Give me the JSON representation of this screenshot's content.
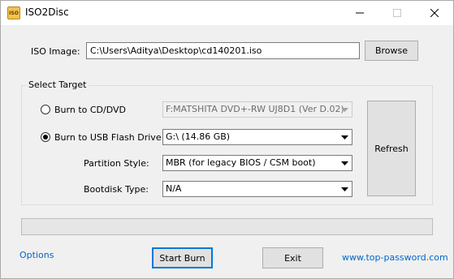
{
  "window": {
    "title": "ISO2Disc",
    "icon_text": "ISO"
  },
  "iso_image": {
    "label": "ISO Image:",
    "value": "C:\\Users\\Aditya\\Desktop\\cd140201.iso",
    "browse_label": "Browse"
  },
  "select_target": {
    "title": "Select Target",
    "burn_cd": {
      "label": "Burn to CD/DVD",
      "selected": false,
      "drive": "F:MATSHITA DVD+-RW UJ8D1 (Ver D.02)"
    },
    "burn_usb": {
      "label": "Burn to USB Flash Drive",
      "selected": true,
      "drive": "G:\\ (14.86 GB)"
    },
    "partition_style": {
      "label": "Partition Style:",
      "value": "MBR (for legacy BIOS / CSM boot)"
    },
    "bootdisk_type": {
      "label": "Bootdisk Type:",
      "value": "N/A"
    },
    "refresh_label": "Refresh"
  },
  "progress": {
    "value": 0
  },
  "footer": {
    "options_label": "Options",
    "start_burn_label": "Start Burn",
    "exit_label": "Exit",
    "website_label": "www.top-password.com"
  },
  "icons": {
    "minimize": "minimize-icon",
    "maximize": "maximize-icon",
    "close": "close-icon",
    "dropdown": "chevron-down-icon"
  },
  "colors": {
    "link": "#0066cc",
    "default_button_border": "#0078d7"
  }
}
